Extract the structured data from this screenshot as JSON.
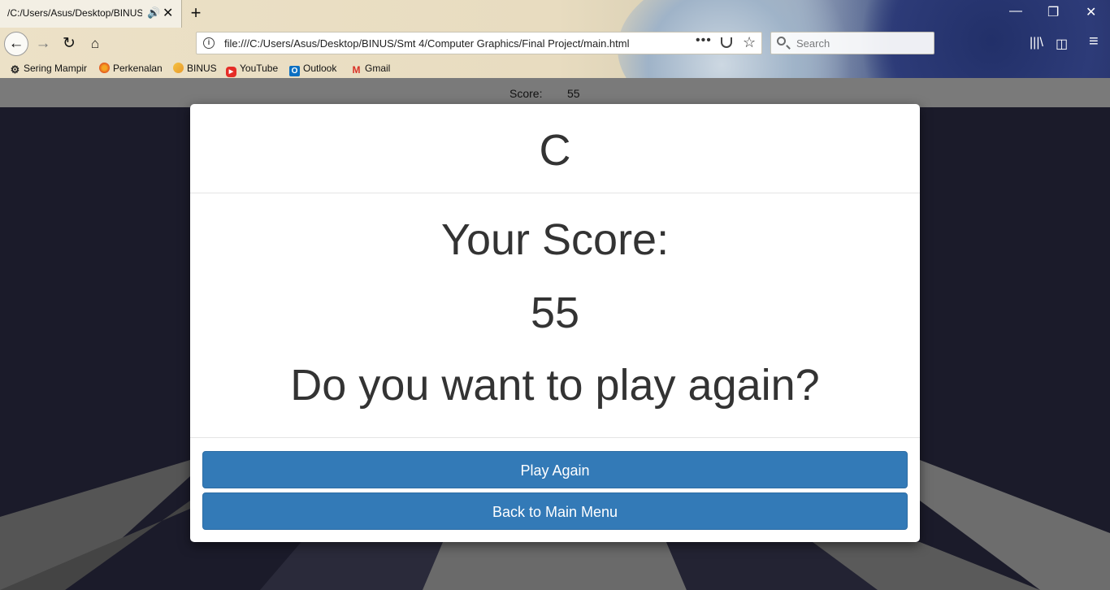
{
  "browser": {
    "tab_title": "/C:/Users/Asus/Desktop/BINUS/",
    "tab_audio_icon": "🔊",
    "tab_close_icon": "✕",
    "new_tab_icon": "+",
    "window_controls": {
      "minimize": "—",
      "restore": "❐",
      "close": "✕"
    },
    "url": "file:///C:/Users/Asus/Desktop/BINUS/Smt 4/Computer Graphics/Final Project/main.html",
    "page_actions_icon": "•••",
    "search_placeholder": "Search",
    "nav_icons": {
      "back": "←",
      "forward": "→",
      "reload": "↻",
      "home": "⌂"
    },
    "toolbar_icons": {
      "library": "|||\\",
      "sidebar": "◫",
      "menu": "≡"
    },
    "bookmarks": [
      {
        "label": "Sering Mampir",
        "icon": "gear-icon"
      },
      {
        "label": "Perkenalan",
        "icon": "firefox-icon"
      },
      {
        "label": "BINUS",
        "icon": "binus-icon"
      },
      {
        "label": "YouTube",
        "icon": "youtube-icon"
      },
      {
        "label": "Outlook",
        "icon": "outlook-icon"
      },
      {
        "label": "Gmail",
        "icon": "gmail-icon"
      }
    ]
  },
  "game": {
    "score_label": "Score:",
    "score_value": "55"
  },
  "modal": {
    "title": "C",
    "score_heading": "Your Score:",
    "score_number": "55",
    "question": "Do you want to play again?",
    "play_again_label": "Play Again",
    "main_menu_label": "Back to Main Menu"
  },
  "colors": {
    "primary_button": "#337ab7",
    "page_background": "#1b1b2a",
    "score_strip": "#7a7a7a"
  }
}
